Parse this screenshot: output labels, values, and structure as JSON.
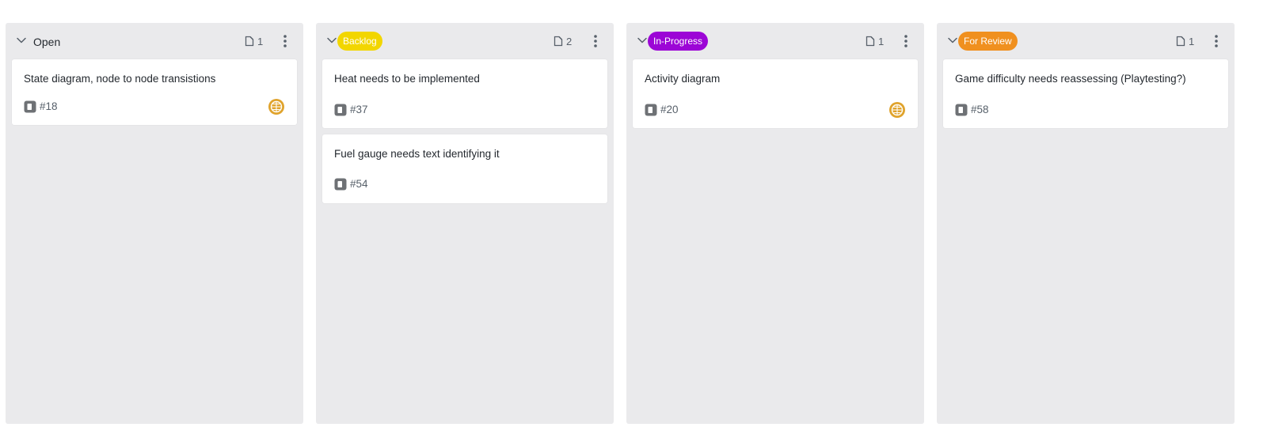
{
  "colors": {
    "column_bg": "#eaeaec",
    "card_bg": "#ffffff",
    "backlog": "#f2d600",
    "in_progress": "#9c06d6",
    "for_review": "#f0901f",
    "avatar": "#e0a32c"
  },
  "columns": [
    {
      "title": "Open",
      "count": "1",
      "cards": [
        {
          "title": "State diagram, node to node transistions",
          "number": "#18",
          "icon": "issue-icon",
          "avatar": "avatar-icon"
        }
      ]
    },
    {
      "label": "Backlog",
      "count": "2",
      "cards": [
        {
          "title": "Heat needs to be implemented",
          "number": "#37",
          "icon": "issue-icon"
        },
        {
          "title": "Fuel gauge needs text identifying it",
          "number": "#54",
          "icon": "issue-icon"
        }
      ]
    },
    {
      "label": "In-Progress",
      "count": "1",
      "cards": [
        {
          "title": "Activity diagram",
          "number": "#20",
          "icon": "issue-icon",
          "avatar": "avatar-icon"
        }
      ]
    },
    {
      "label": "For Review",
      "count": "1",
      "cards": [
        {
          "title": "Game difficulty needs reassessing (Playtesting?)",
          "number": "#58",
          "icon": "issue-icon"
        }
      ]
    }
  ]
}
